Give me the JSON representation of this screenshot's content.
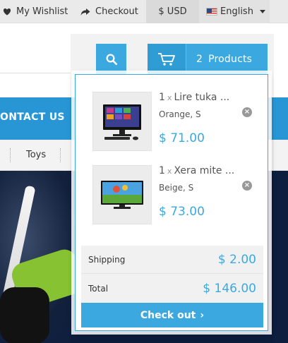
{
  "topbar": {
    "wishlist_label": "My Wishlist",
    "checkout_label": "Checkout",
    "currency_label": "$ USD",
    "language_label": "English"
  },
  "header": {
    "search_icon": "search-icon",
    "cart": {
      "count": "2",
      "count_label": "Products"
    }
  },
  "nav": {
    "visible_label": "ONTACT US"
  },
  "subnav": {
    "visible_label": "Toys"
  },
  "cart_dropdown": {
    "items": [
      {
        "qty": "1",
        "times": "x",
        "name": "Lire tuka ...",
        "variant": "Orange, S",
        "price": "$ 71.00"
      },
      {
        "qty": "1",
        "times": "x",
        "name": "Xera mite ...",
        "variant": "Beige, S",
        "price": "$ 73.00"
      }
    ],
    "shipping_label": "Shipping",
    "shipping_value": "$ 2.00",
    "total_label": "Total",
    "total_value": "$ 146.00",
    "checkout_button": "Check out"
  },
  "colors": {
    "accent": "#3ba9e0",
    "nav": "#2895d4",
    "topbar": "#eaeaea"
  }
}
